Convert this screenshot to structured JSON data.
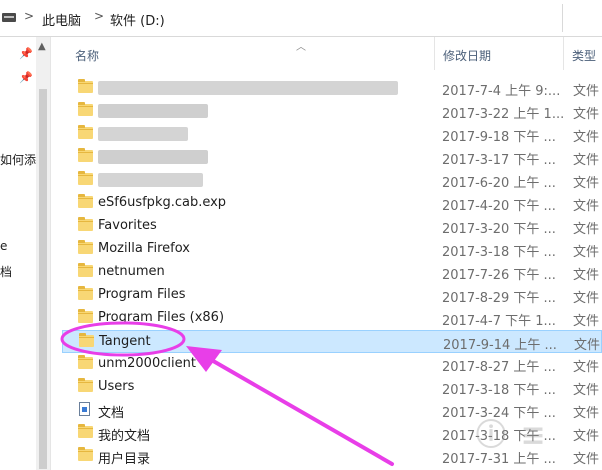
{
  "breadcrumb": {
    "sep1": ">",
    "pc": "此电脑",
    "sep2": ">",
    "drive": "软件 (D:)"
  },
  "nav": {
    "item1": "如何添",
    "item2": "e",
    "item3": "档"
  },
  "columns": {
    "name": "名称",
    "date": "修改日期",
    "type": "类型"
  },
  "rows": [
    {
      "name": "",
      "date": "2017-7-4 上午 9:...",
      "type": "文件",
      "blurred": true
    },
    {
      "name": "",
      "date": "2017-3-22 上午 1...",
      "type": "文件",
      "blurred": true
    },
    {
      "name": "",
      "date": "2017-9-18 下午 ...",
      "type": "文件",
      "blurred": true
    },
    {
      "name": "",
      "date": "2017-3-17 下午 ...",
      "type": "文件",
      "blurred": true
    },
    {
      "name": "",
      "date": "2017-6-20 上午 ...",
      "type": "文件",
      "blurred": true
    },
    {
      "name": "eSf6usfpkg.cab.exp",
      "date": "2017-4-20 下午 ...",
      "type": "文件"
    },
    {
      "name": "Favorites",
      "date": "2017-3-20 下午 ...",
      "type": "文件"
    },
    {
      "name": "Mozilla Firefox",
      "date": "2017-3-18 下午 ...",
      "type": "文件"
    },
    {
      "name": "netnumen",
      "date": "2017-7-26 下午 ...",
      "type": "文件"
    },
    {
      "name": "Program Files",
      "date": "2017-8-29 下午 ...",
      "type": "文件"
    },
    {
      "name": "Program Files (x86)",
      "date": "2017-4-7 下午 1...",
      "type": "文件"
    },
    {
      "name": "Tangent",
      "date": "2017-9-14 上午 ...",
      "type": "文件",
      "selected": true
    },
    {
      "name": "unm2000client",
      "date": "2017-8-27 上午 ...",
      "type": "文件"
    },
    {
      "name": "Users",
      "date": "2017-3-18 下午 ...",
      "type": "文件"
    },
    {
      "name": "文档",
      "date": "2017-3-24 下午 ...",
      "type": "文件",
      "icon": "document-icon"
    },
    {
      "name": "我的文档",
      "date": "2017-3-18 下午 ...",
      "type": "文件"
    },
    {
      "name": "用户目录",
      "date": "2017-7-31 上午 ...",
      "type": "文件"
    }
  ],
  "colors": {
    "selection": "#cce8ff",
    "annotation": "#e83ee8",
    "folder": "#f8d775"
  }
}
